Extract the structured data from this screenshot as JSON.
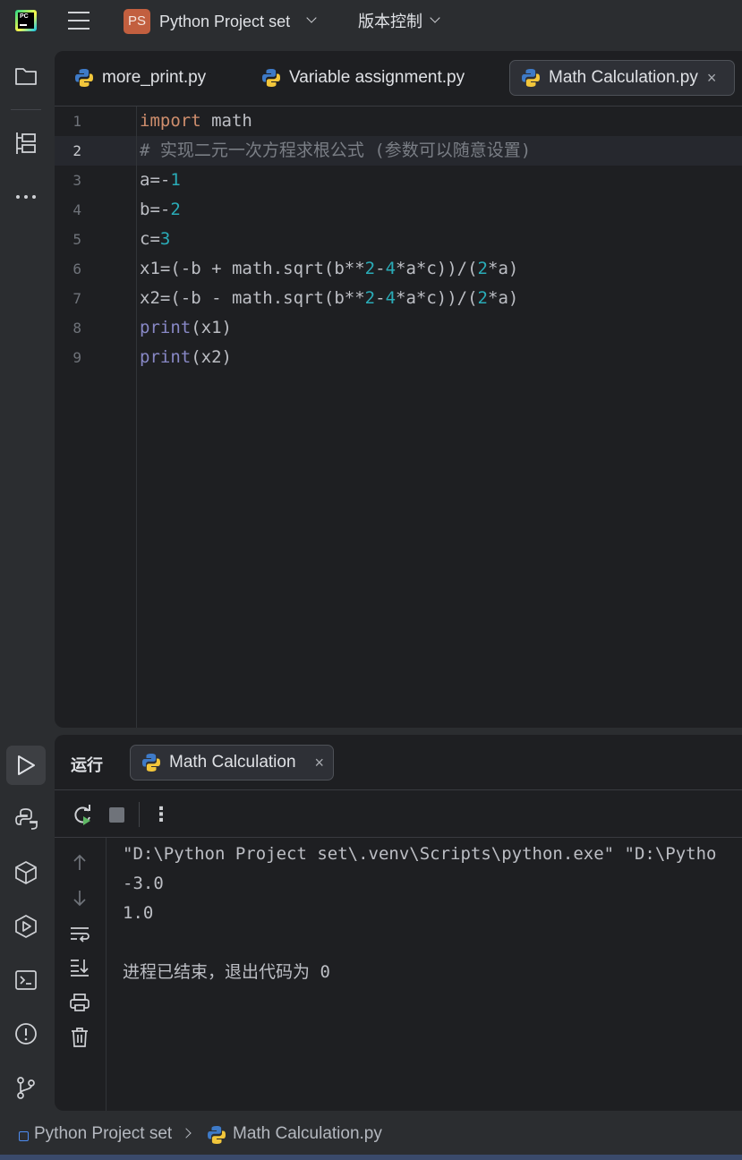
{
  "titlebar": {
    "logo_text": "PC",
    "project_badge": "PS",
    "project_name": "Python Project set",
    "vcs_label": "版本控制"
  },
  "editor": {
    "tabs": [
      {
        "label": "more_print.py",
        "active": false
      },
      {
        "label": "Variable assignment.py",
        "active": false
      },
      {
        "label": "Math Calculation.py",
        "active": true,
        "close": "×"
      }
    ],
    "current_line": 2,
    "line_numbers": [
      "1",
      "2",
      "3",
      "4",
      "5",
      "6",
      "7",
      "8",
      "9"
    ]
  },
  "run": {
    "title": "运行",
    "tab_label": "Math Calculation",
    "tab_close": "×",
    "more": "⋮",
    "output": [
      "\"D:\\Python Project set\\.venv\\Scripts\\python.exe\" \"D:\\Pytho",
      "-3.0",
      "1.0",
      "",
      "进程已结束，退出代码为 0"
    ]
  },
  "statusbar": {
    "project": "Python Project set",
    "file": "Math Calculation.py"
  },
  "colors": {
    "keyword": "#cf8e6d",
    "number": "#2aacb8",
    "builtin": "#8888c6",
    "comment": "#7a7e85",
    "editor_bg": "#1e1f22",
    "chrome_bg": "#2b2d30"
  }
}
